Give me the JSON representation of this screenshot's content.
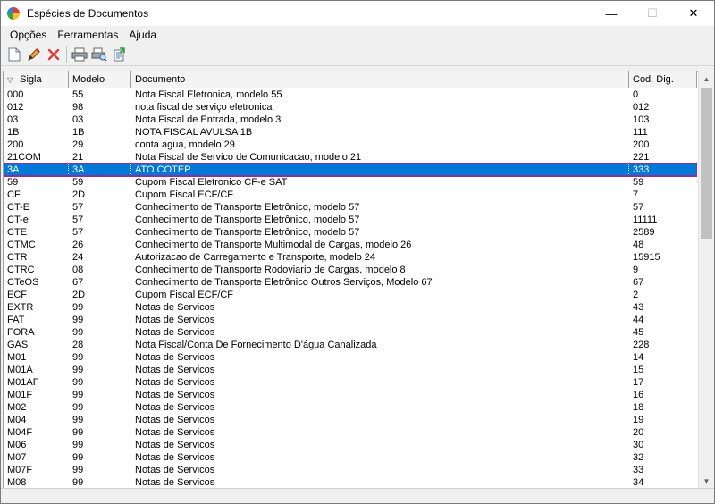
{
  "window": {
    "title": "Espécies de Documentos"
  },
  "window_controls": {
    "minimize": "—",
    "maximize": "☐",
    "close": "✕"
  },
  "menu": [
    {
      "label": "Opções"
    },
    {
      "label": "Ferramentas"
    },
    {
      "label": "Ajuda"
    }
  ],
  "columns": [
    "Sigla",
    "Modelo",
    "Documento",
    "Cod. Dig."
  ],
  "rows": [
    [
      "000",
      "55",
      "Nota Fiscal Eletronica, modelo 55",
      "0"
    ],
    [
      "012",
      "98",
      "nota fiscal de serviço eletronica",
      "012"
    ],
    [
      "03",
      "03",
      "Nota Fiscal de Entrada, modelo 3",
      "103"
    ],
    [
      "1B",
      "1B",
      "NOTA FISCAL AVULSA 1B",
      "111"
    ],
    [
      "200",
      "29",
      "conta agua, modelo 29",
      "200"
    ],
    [
      "21COM",
      "21",
      "Nota Fiscal de Servico de Comunicacao, modelo 21",
      "221"
    ],
    [
      "3A",
      "3A",
      "ATO COTEP",
      "333"
    ],
    [
      "59",
      "59",
      "Cupom Fiscal Eletronico CF-e SAT",
      "59"
    ],
    [
      "CF",
      "2D",
      "Cupom Fiscal ECF/CF",
      "7"
    ],
    [
      "CT-E",
      "57",
      "Conhecimento de Transporte Eletrônico, modelo 57",
      "57"
    ],
    [
      "CT-e",
      "57",
      "Conhecimento de Transporte Eletrônico, modelo 57",
      "11111"
    ],
    [
      "CTE",
      "57",
      "Conhecimento de Transporte Eletrônico, modelo 57",
      "2589"
    ],
    [
      "CTMC",
      "26",
      "Conhecimento de Transporte Multimodal de Cargas, modelo 26",
      "48"
    ],
    [
      "CTR",
      "24",
      "Autorizacao de Carregamento e Transporte, modelo 24",
      "15915"
    ],
    [
      "CTRC",
      "08",
      "Conhecimento de Transporte Rodoviario de Cargas, modelo 8",
      "9"
    ],
    [
      "CTeOS",
      "67",
      "Conhecimento de Transporte Eletrônico Outros Serviços, Modelo 67",
      "67"
    ],
    [
      "ECF",
      "2D",
      "Cupom Fiscal ECF/CF",
      "2"
    ],
    [
      "EXTR",
      "99",
      "Notas de Servicos",
      "43"
    ],
    [
      "FAT",
      "99",
      "Notas de Servicos",
      "44"
    ],
    [
      "FORA",
      "99",
      "Notas de Servicos",
      "45"
    ],
    [
      "GAS",
      "28",
      "Nota Fiscal/Conta De Fornecimento D'água Canalizada",
      "228"
    ],
    [
      "M01",
      "99",
      "Notas de Servicos",
      "14"
    ],
    [
      "M01A",
      "99",
      "Notas de Servicos",
      "15"
    ],
    [
      "M01AF",
      "99",
      "Notas de Servicos",
      "17"
    ],
    [
      "M01F",
      "99",
      "Notas de Servicos",
      "16"
    ],
    [
      "M02",
      "99",
      "Notas de Servicos",
      "18"
    ],
    [
      "M04",
      "99",
      "Notas de Servicos",
      "19"
    ],
    [
      "M04F",
      "99",
      "Notas de Servicos",
      "20"
    ],
    [
      "M06",
      "99",
      "Notas de Servicos",
      "30"
    ],
    [
      "M07",
      "99",
      "Notas de Servicos",
      "32"
    ],
    [
      "M07F",
      "99",
      "Notas de Servicos",
      "33"
    ],
    [
      "M08",
      "99",
      "Notas de Servicos",
      "34"
    ]
  ],
  "selected_row": 6,
  "colors": {
    "selection": "#0078d7",
    "selection_outline": "#8e2f9e"
  }
}
